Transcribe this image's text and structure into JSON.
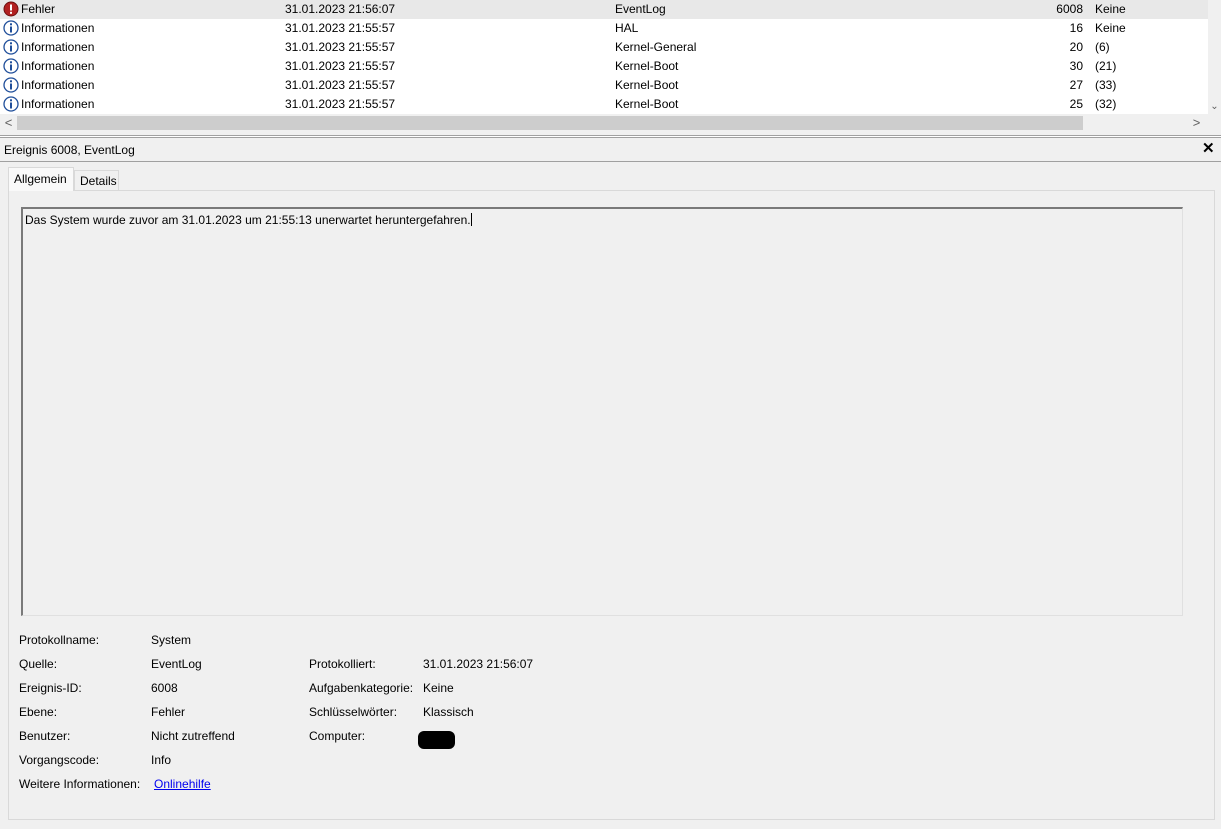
{
  "events": {
    "rows": [
      {
        "level": "Fehler",
        "datetime": "31.01.2023 21:56:07",
        "source": "EventLog",
        "event_id": "6008",
        "category": "Keine",
        "icon": "error-icon",
        "selected": true
      },
      {
        "level": "Informationen",
        "datetime": "31.01.2023 21:55:57",
        "source": "HAL",
        "event_id": "16",
        "category": "Keine",
        "icon": "info-icon",
        "selected": false
      },
      {
        "level": "Informationen",
        "datetime": "31.01.2023 21:55:57",
        "source": "Kernel-General",
        "event_id": "20",
        "category": "(6)",
        "icon": "info-icon",
        "selected": false
      },
      {
        "level": "Informationen",
        "datetime": "31.01.2023 21:55:57",
        "source": "Kernel-Boot",
        "event_id": "30",
        "category": "(21)",
        "icon": "info-icon",
        "selected": false
      },
      {
        "level": "Informationen",
        "datetime": "31.01.2023 21:55:57",
        "source": "Kernel-Boot",
        "event_id": "27",
        "category": "(33)",
        "icon": "info-icon",
        "selected": false
      },
      {
        "level": "Informationen",
        "datetime": "31.01.2023 21:55:57",
        "source": "Kernel-Boot",
        "event_id": "25",
        "category": "(32)",
        "icon": "info-icon",
        "selected": false
      }
    ],
    "scroll": {
      "left_arrow": "<",
      "right_arrow": ">",
      "down_arrow": "⌄"
    }
  },
  "detail": {
    "title": "Ereignis 6008, EventLog",
    "close_label": "✕",
    "tabs": [
      {
        "label": "Allgemein",
        "active": true
      },
      {
        "label": "Details",
        "active": false
      }
    ],
    "description": "Das System wurde zuvor am 31.01.2023 um 21:55:13 unerwartet heruntergefahren.",
    "props": {
      "log_name": {
        "label": "Protokollname:",
        "value": "System"
      },
      "source": {
        "label": "Quelle:",
        "value": "EventLog"
      },
      "logged": {
        "label": "Protokolliert:",
        "value": "31.01.2023 21:56:07"
      },
      "event_id": {
        "label": "Ereignis-ID:",
        "value": "6008"
      },
      "task_category": {
        "label": "Aufgabenkategorie:",
        "value": "Keine"
      },
      "level": {
        "label": "Ebene:",
        "value": "Fehler"
      },
      "keywords": {
        "label": "Schlüsselwörter:",
        "value": "Klassisch"
      },
      "user": {
        "label": "Benutzer:",
        "value": "Nicht zutreffend"
      },
      "computer": {
        "label": "Computer:",
        "value": ""
      },
      "opcode": {
        "label": "Vorgangscode:",
        "value": "Info"
      },
      "more_info": {
        "label": "Weitere Informationen:",
        "value": "Onlinehilfe"
      }
    }
  },
  "colors": {
    "selected_row": "#e8e8e8",
    "link": "#0000ee",
    "error": "#b22020",
    "info": "#1f4e9a"
  }
}
